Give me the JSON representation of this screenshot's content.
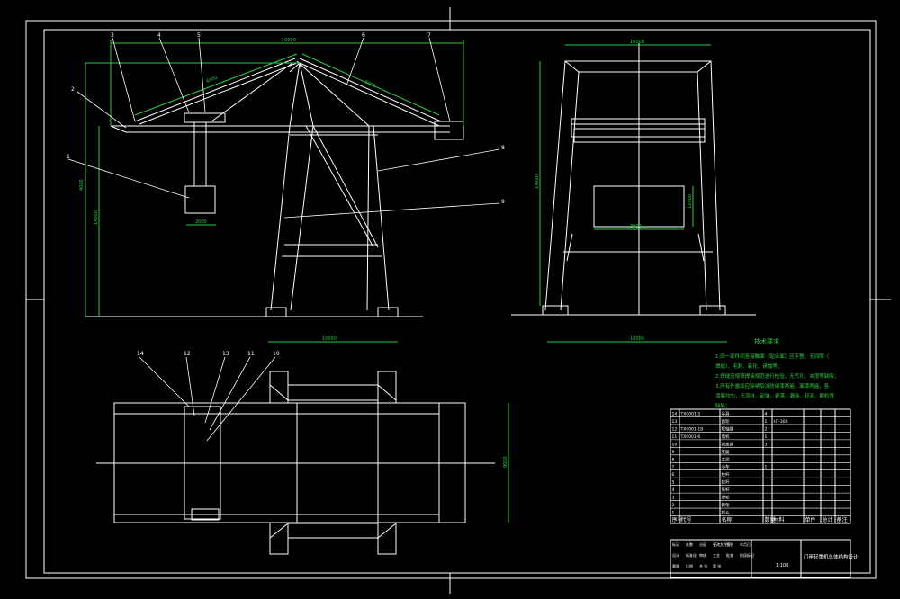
{
  "leaders": [
    "1",
    "2",
    "3",
    "4",
    "5",
    "6",
    "7",
    "8",
    "9"
  ],
  "plan_leaders": [
    "14",
    "12",
    "13",
    "11",
    "10"
  ],
  "dims": {
    "span_top": "10000",
    "boom_left": "6000",
    "boom_right": "6000",
    "hook_height": "4000",
    "total_height": "14000",
    "bucket_width": "2000",
    "base_width": "10000",
    "side_top": "10000",
    "side_height": "14000",
    "side_inner": "12000",
    "side_bucket": "3000",
    "side_base": "10000",
    "plan_height": "9000"
  },
  "notes": {
    "title": "技术要求",
    "items": [
      "1.同一部件间各接触面（贴合面）应平整、无间隙（",
      "焊缝）、毛刺、氧化、锈蚀等；",
      "2.焊缝应按照焊接规范进行检验，无气孔、夹渣等缺陷；",
      "3.所有外露面应除锈后涂防锈漆两遍，面漆两遍，各",
      "漆膜均匀，无流挂、起皱、剥落、漏涂、起泡、颗粒等",
      "缺陷；"
    ]
  },
  "bom": {
    "header": [
      "序号",
      "代号",
      "名称",
      "数量",
      "材料",
      "单件",
      "总计",
      "备注"
    ],
    "rows": [
      [
        "14",
        "TX0001-5",
        "吊具",
        "4",
        "",
        "",
        "",
        ""
      ],
      [
        "13",
        "",
        "齿轮",
        "1",
        "HT-300",
        "",
        "",
        ""
      ],
      [
        "12",
        "TX0001-18",
        "联轴器",
        "2",
        "",
        "",
        "",
        ""
      ],
      [
        "11",
        "TX0001-6",
        "电机",
        "1",
        "",
        "",
        "",
        ""
      ],
      [
        "10",
        "",
        "减速器",
        "3",
        "",
        "",
        "",
        ""
      ],
      [
        "9",
        "",
        "支腿",
        "",
        "",
        "",
        "",
        ""
      ],
      [
        "8",
        "",
        "主梁",
        "",
        "",
        "",
        "",
        ""
      ],
      [
        "7",
        "",
        "小车",
        "1",
        "",
        "",
        "",
        ""
      ],
      [
        "6",
        "",
        "拉杆",
        "",
        "",
        "",
        "",
        ""
      ],
      [
        "5",
        "",
        "拉杆",
        "",
        "",
        "",
        "",
        ""
      ],
      [
        "4",
        "",
        "吊杆",
        "",
        "",
        "",
        "",
        ""
      ],
      [
        "3",
        "",
        "滑轮",
        "",
        "",
        "",
        "",
        ""
      ],
      [
        "2",
        "",
        "臂架",
        "",
        "",
        "",
        "",
        ""
      ],
      [
        "1",
        "",
        "抓斗",
        "",
        "",
        "",
        "",
        ""
      ]
    ]
  },
  "title_block": {
    "name": "门座起重机总体结构设计",
    "scale": "1:100",
    "cells": [
      "标记",
      "处数",
      "分区",
      "更改文件号",
      "签名",
      "年月日",
      "设计",
      "标准化",
      "审核",
      "工艺",
      "批准",
      "阶段标记",
      "重量",
      "比例",
      "共  张",
      "第  张"
    ]
  }
}
